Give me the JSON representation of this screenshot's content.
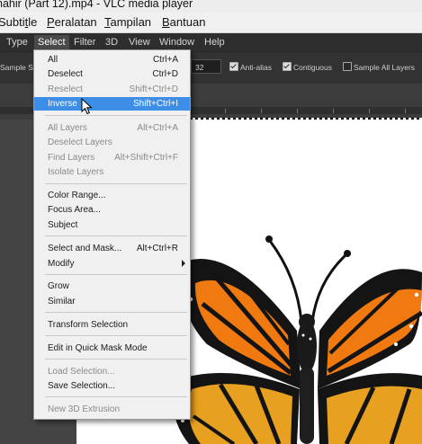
{
  "vlc": {
    "title": "nahir (Part 12).mp4 - VLC media player",
    "menu": {
      "subtitle": {
        "before": "Subti",
        "u": "t",
        "after": "le"
      },
      "tools": {
        "before": "",
        "u": "P",
        "after": "eralatan"
      },
      "view": {
        "before": "",
        "u": "T",
        "after": "ampilan"
      },
      "help": {
        "before": "",
        "u": "B",
        "after": "antuan"
      }
    }
  },
  "ps_menu": [
    "Type",
    "Select",
    "Filter",
    "3D",
    "View",
    "Window",
    "Help"
  ],
  "options_bar": {
    "sample_label": "Sample S",
    "tolerance": "32",
    "anti_alias": "Anti-alias",
    "contiguous": "Contiguous",
    "sample_all_layers": "Sample All Layers"
  },
  "select_menu": [
    {
      "label": "All",
      "shortcut": "Ctrl+A",
      "disabled": false
    },
    {
      "label": "Deselect",
      "shortcut": "Ctrl+D",
      "disabled": false
    },
    {
      "label": "Reselect",
      "shortcut": "Shift+Ctrl+D",
      "disabled": true
    },
    {
      "label": "Inverse",
      "shortcut": "Shift+Ctrl+I",
      "disabled": false,
      "highlighted": true
    },
    {
      "label": "All Layers",
      "shortcut": "Alt+Ctrl+A",
      "disabled": true
    },
    {
      "label": "Deselect Layers",
      "shortcut": "",
      "disabled": true
    },
    {
      "label": "Find Layers",
      "shortcut": "Alt+Shift+Ctrl+F",
      "disabled": true
    },
    {
      "label": "Isolate Layers",
      "shortcut": "",
      "disabled": true
    },
    {
      "label": "Color Range...",
      "shortcut": "",
      "disabled": false
    },
    {
      "label": "Focus Area...",
      "shortcut": "",
      "disabled": false
    },
    {
      "label": "Subject",
      "shortcut": "",
      "disabled": false
    },
    {
      "label": "Select and Mask...",
      "shortcut": "Alt+Ctrl+R",
      "disabled": false
    },
    {
      "label": "Modify",
      "shortcut": "",
      "disabled": false,
      "submenu": true
    },
    {
      "label": "Grow",
      "shortcut": "",
      "disabled": false
    },
    {
      "label": "Similar",
      "shortcut": "",
      "disabled": false
    },
    {
      "label": "Transform Selection",
      "shortcut": "",
      "disabled": false
    },
    {
      "label": "Edit in Quick Mask Mode",
      "shortcut": "",
      "disabled": false
    },
    {
      "label": "Load Selection...",
      "shortcut": "",
      "disabled": true
    },
    {
      "label": "Save Selection...",
      "shortcut": "",
      "disabled": false
    },
    {
      "label": "New 3D Extrusion",
      "shortcut": "",
      "disabled": true
    }
  ],
  "colors": {
    "highlight": "#3d8ee6",
    "wing_orange": "#f07a10",
    "wing_black": "#141414"
  },
  "icons": [
    "pointer-cursor-icon",
    "submenu-arrow-icon",
    "checkbox-icon"
  ]
}
